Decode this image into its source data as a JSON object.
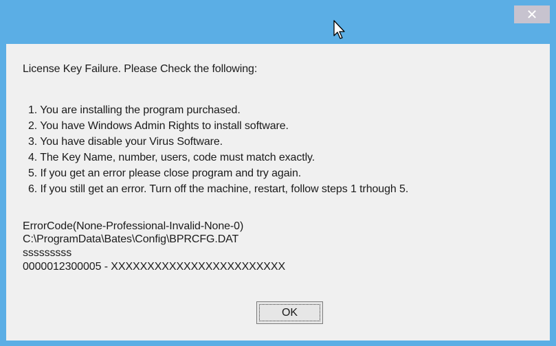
{
  "titlebar": {
    "close_icon": "close-icon",
    "close_glyph": "✕",
    "cursor_icon": "mouse-pointer-icon"
  },
  "message": {
    "heading": "License Key Failure. Please Check the following:",
    "steps": [
      "1. You are installing the program purchased.",
      "2. You have Windows Admin Rights to install software.",
      "3. You have disable your Virus Software.",
      "4. The Key Name, number, users, code must match exactly.",
      "5. If you get an error please close program and try again.",
      "6. If you still get an error. Turn off the machine, restart, follow steps 1 trhough 5."
    ],
    "error_code": "ErrorCode(None-Professional-Invalid-None-0)",
    "config_path": "C:\\ProgramData\\Bates\\Config\\BPRCFG.DAT",
    "user_line": "sssssssss",
    "key_line": "0000012300005 - XXXXXXXXXXXXXXXXXXXXXXXX"
  },
  "buttons": {
    "ok_label": "OK"
  },
  "colors": {
    "titlebar": "#5baee5",
    "client": "#f0f0f0",
    "close_button": "#c7c3cf"
  }
}
